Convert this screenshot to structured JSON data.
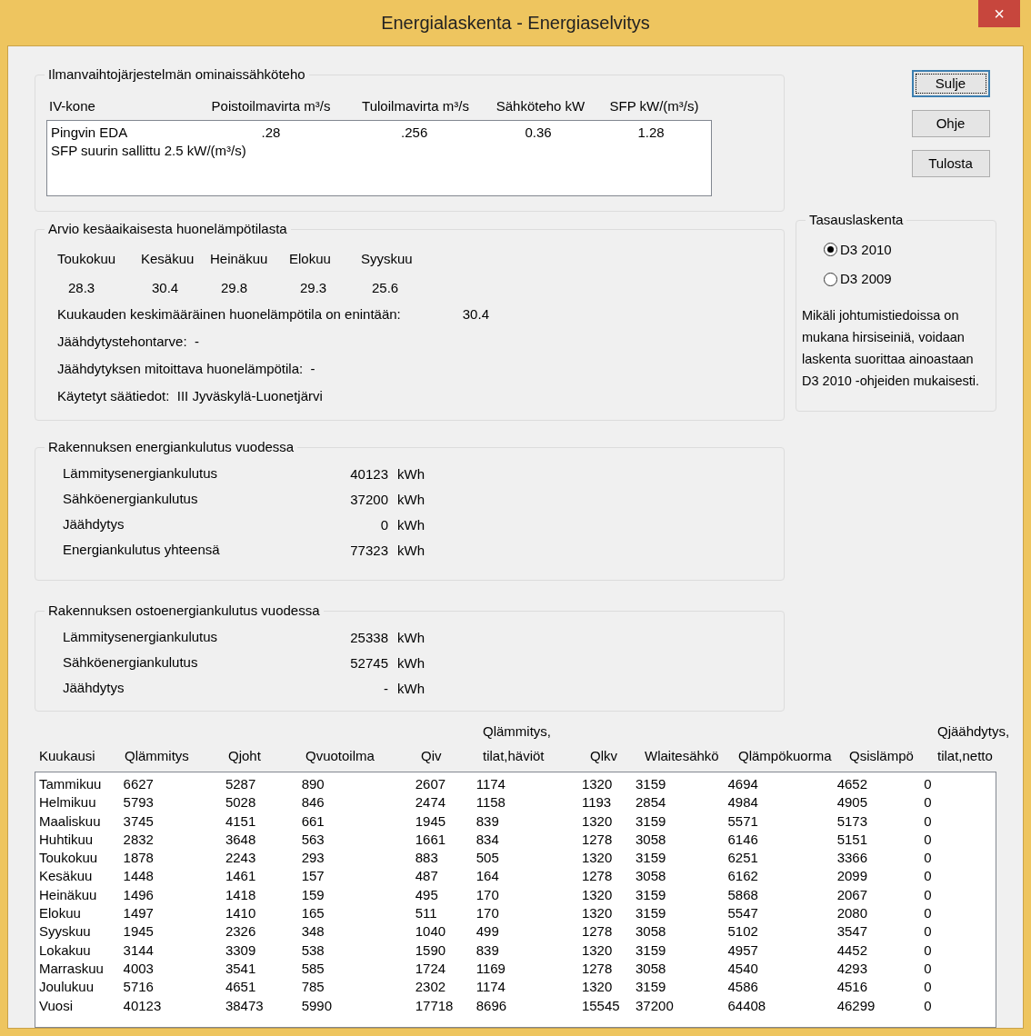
{
  "window": {
    "title": "Energialaskenta - Energiaselvitys",
    "close": "×"
  },
  "ventilation": {
    "title": "Ilmanvaihtojärjestelmän ominaissähköteho",
    "columns": [
      "IV-kone",
      "Poistoilmavirta m³/s",
      "Tuloilmavirta m³/s",
      "Sähköteho kW",
      "SFP kW/(m³/s)"
    ],
    "row": [
      "Pingvin EDA",
      ".28",
      ".256",
      "0.36",
      "1.28"
    ],
    "note": "SFP suurin sallittu 2.5 kW/(m³/s)"
  },
  "buttons": [
    {
      "label": "Sulje",
      "focused": true
    },
    {
      "label": "Ohje",
      "focused": false
    },
    {
      "label": "Tulosta",
      "focused": false
    }
  ],
  "summer": {
    "title": "Arvio kesäaikaisesta huonelämpötilasta",
    "months": [
      "Toukokuu",
      "Kesäkuu",
      "Heinäkuu",
      "Elokuu",
      "Syyskuu"
    ],
    "temps": [
      "28.3",
      "30.4",
      "29.8",
      "29.3",
      "25.6"
    ],
    "lines": [
      {
        "label": "Kuukauden keskimääräinen huonelämpötila on enintään:",
        "value": "30.4"
      },
      {
        "text": "Jäähdytystehontarve:  -"
      },
      {
        "text": "Jäähdytyksen mitoittava huonelämpötila:  -"
      },
      {
        "text": "Käytetyt säätiedot:  III Jyväskylä-Luonetjärvi"
      }
    ]
  },
  "balancing": {
    "title": "Tasauslaskenta",
    "options": [
      {
        "label": "D3 2010",
        "selected": true
      },
      {
        "label": "D3 2009",
        "selected": false
      }
    ],
    "note": "Mikäli johtumistiedoissa on mukana hirsiseiniä, voidaan laskenta suorittaa ainoastaan D3 2010 -ohjeiden mukaisesti."
  },
  "energy_groups": [
    {
      "title": "Rakennuksen energiankulutus vuodessa",
      "rows": [
        {
          "label": "Lämmitysenergiankulutus",
          "value": "40123",
          "unit": "kWh"
        },
        {
          "label": "Sähköenergiankulutus",
          "value": "37200",
          "unit": "kWh"
        },
        {
          "label": "Jäähdytys",
          "value": "0",
          "unit": "kWh"
        },
        {
          "label": "Energiankulutus yhteensä",
          "value": "77323",
          "unit": "kWh"
        }
      ]
    },
    {
      "title": "Rakennuksen ostoenergiankulutus vuodessa",
      "rows": [
        {
          "label": "Lämmitysenergiankulutus",
          "value": "25338",
          "unit": "kWh"
        },
        {
          "label": "Sähköenergiankulutus",
          "value": "52745",
          "unit": "kWh"
        },
        {
          "label": "Jäähdytys",
          "value": "-",
          "unit": "kWh"
        }
      ]
    }
  ],
  "table": {
    "columns": [
      {
        "label": "Kuukausi"
      },
      {
        "label": "Qlämmitys"
      },
      {
        "label": "Qjoht"
      },
      {
        "label": "Qvuotoilma"
      },
      {
        "label": "Qiv"
      },
      {
        "above": "Qlämmitys,",
        "label": "tilat,häviöt"
      },
      {
        "label": "Qlkv"
      },
      {
        "label": "Wlaitesähkö"
      },
      {
        "label": "Qlämpökuorma"
      },
      {
        "label": "Qsislämpö"
      },
      {
        "above": "Qjäähdytys,",
        "label": "tilat,netto"
      }
    ],
    "rows": [
      [
        "Tammikuu",
        "6627",
        "5287",
        "890",
        "2607",
        "1174",
        "1320",
        "3159",
        "4694",
        "4652",
        "0"
      ],
      [
        "Helmikuu",
        "5793",
        "5028",
        "846",
        "2474",
        "1158",
        "1193",
        "2854",
        "4984",
        "4905",
        "0"
      ],
      [
        "Maaliskuu",
        "3745",
        "4151",
        "661",
        "1945",
        "839",
        "1320",
        "3159",
        "5571",
        "5173",
        "0"
      ],
      [
        "Huhtikuu",
        "2832",
        "3648",
        "563",
        "1661",
        "834",
        "1278",
        "3058",
        "6146",
        "5151",
        "0"
      ],
      [
        "Toukokuu",
        "1878",
        "2243",
        "293",
        "883",
        "505",
        "1320",
        "3159",
        "6251",
        "3366",
        "0"
      ],
      [
        "Kesäkuu",
        "1448",
        "1461",
        "157",
        "487",
        "164",
        "1278",
        "3058",
        "6162",
        "2099",
        "0"
      ],
      [
        "Heinäkuu",
        "1496",
        "1418",
        "159",
        "495",
        "170",
        "1320",
        "3159",
        "5868",
        "2067",
        "0"
      ],
      [
        "Elokuu",
        "1497",
        "1410",
        "165",
        "511",
        "170",
        "1320",
        "3159",
        "5547",
        "2080",
        "0"
      ],
      [
        "Syyskuu",
        "1945",
        "2326",
        "348",
        "1040",
        "499",
        "1278",
        "3058",
        "5102",
        "3547",
        "0"
      ],
      [
        "Lokakuu",
        "3144",
        "3309",
        "538",
        "1590",
        "839",
        "1320",
        "3159",
        "4957",
        "4452",
        "0"
      ],
      [
        "Marraskuu",
        "4003",
        "3541",
        "585",
        "1724",
        "1169",
        "1278",
        "3058",
        "4540",
        "4293",
        "0"
      ],
      [
        "Joulukuu",
        "5716",
        "4651",
        "785",
        "2302",
        "1174",
        "1320",
        "3159",
        "4586",
        "4516",
        "0"
      ],
      [
        "Vuosi",
        "40123",
        "38473",
        "5990",
        "17718",
        "8696",
        "15545",
        "37200",
        "64408",
        "46299",
        "0"
      ]
    ]
  }
}
